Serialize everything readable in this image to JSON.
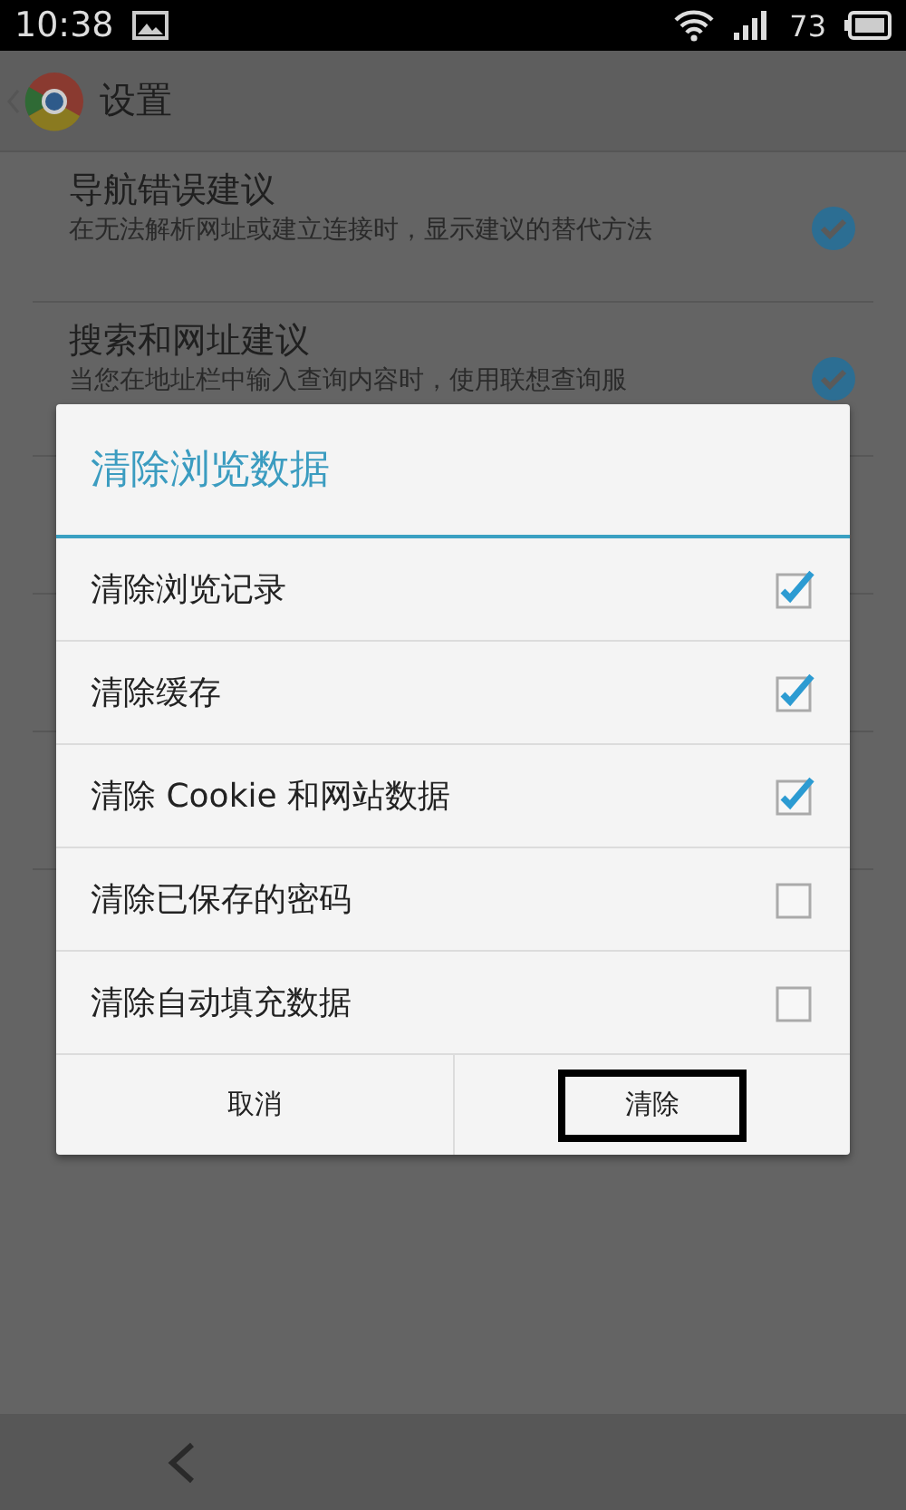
{
  "status_bar": {
    "time": "10:38",
    "battery": "73"
  },
  "action_bar": {
    "title": "设置"
  },
  "settings": [
    {
      "title": "导航错误建议",
      "summary": "在无法解析网址或建立连接时，显示建议的替代方法",
      "checked": true
    },
    {
      "title": "搜索和网址建议",
      "summary": "当您在地址栏中输入查询内容时，使用联想查询服",
      "checked": true
    }
  ],
  "dialog": {
    "title": "清除浏览数据",
    "options": [
      {
        "label": "清除浏览记录",
        "checked": true
      },
      {
        "label": "清除缓存",
        "checked": true
      },
      {
        "label": "清除 Cookie 和网站数据",
        "checked": true
      },
      {
        "label": "清除已保存的密码",
        "checked": false
      },
      {
        "label": "清除自动填充数据",
        "checked": false
      }
    ],
    "buttons": [
      {
        "label": "取消",
        "highlighted": false
      },
      {
        "label": "清除",
        "highlighted": true
      }
    ]
  }
}
